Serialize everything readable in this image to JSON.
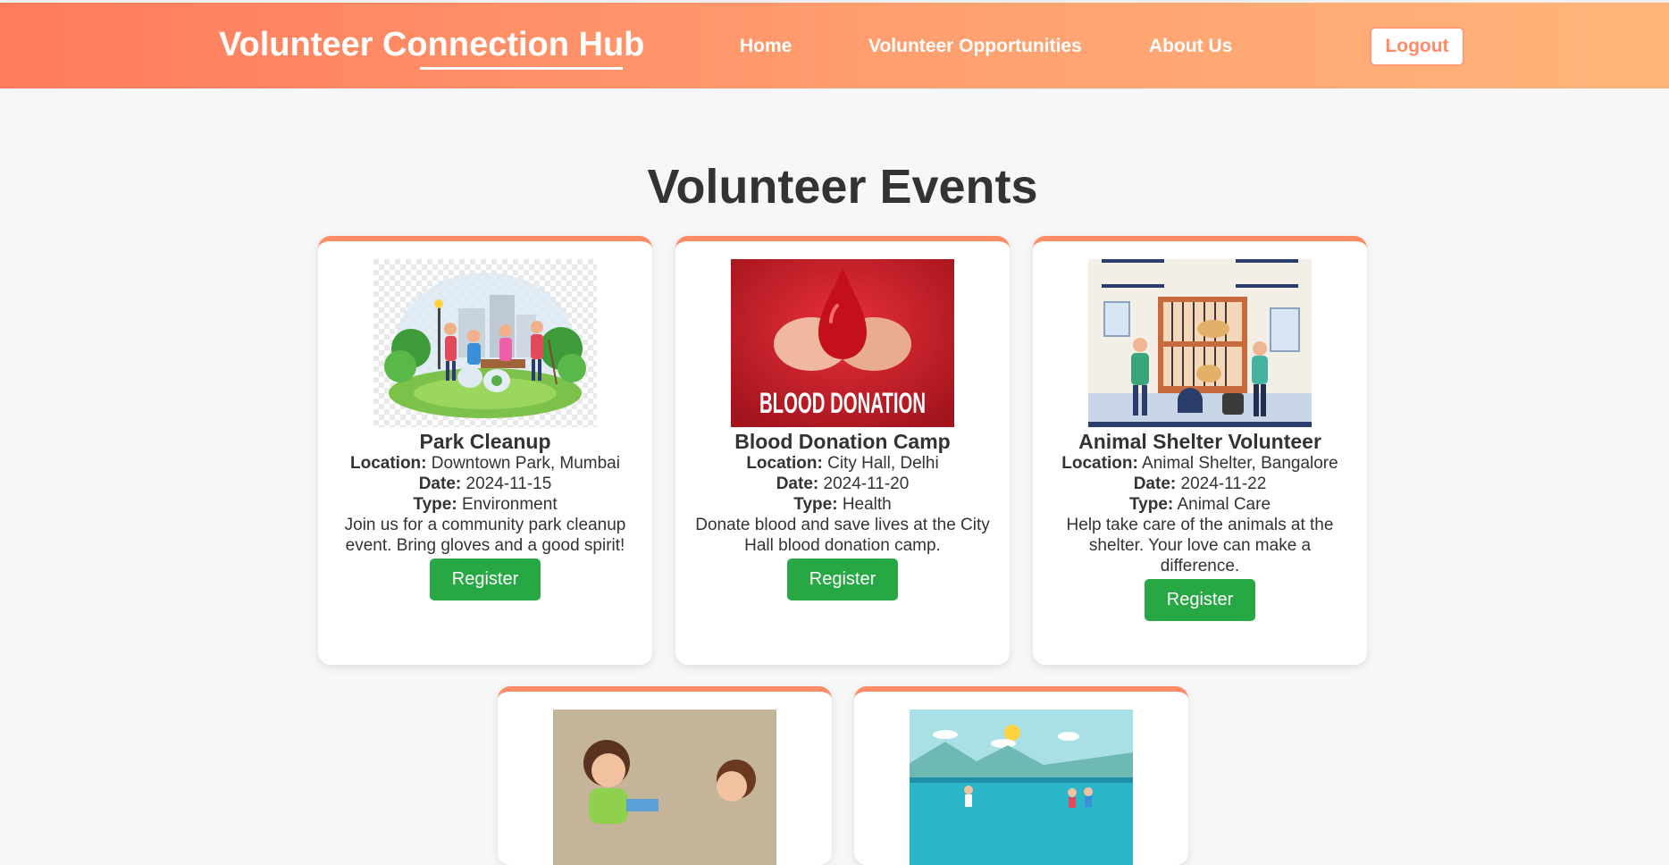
{
  "header": {
    "brand": "Volunteer Connection Hub",
    "nav": [
      "Home",
      "Volunteer Opportunities",
      "About Us"
    ],
    "logout": "Logout"
  },
  "main": {
    "title": "Volunteer Events",
    "events": [
      {
        "title": "Park Cleanup",
        "location_label": "Location:",
        "location": "Downtown Park, Mumbai",
        "date_label": "Date:",
        "date": "2024-11-15",
        "type_label": "Type:",
        "type": "Environment",
        "description": "Join us for a community park cleanup event. Bring gloves and a good spirit!",
        "button": "Register"
      },
      {
        "title": "Blood Donation Camp",
        "location_label": "Location:",
        "location": "City Hall, Delhi",
        "date_label": "Date:",
        "date": "2024-11-20",
        "type_label": "Type:",
        "type": "Health",
        "description": "Donate blood and save lives at the City Hall blood donation camp.",
        "button": "Register",
        "image_text": "BLOOD DONATION"
      },
      {
        "title": "Animal Shelter Volunteer",
        "location_label": "Location:",
        "location": "Animal Shelter, Bangalore",
        "date_label": "Date:",
        "date": "2024-11-22",
        "type_label": "Type:",
        "type": "Animal Care",
        "description": "Help take care of the animals at the shelter. Your love can make a difference.",
        "button": "Register"
      }
    ]
  },
  "colors": {
    "accent": "#ff7b5c",
    "accent_light": "#ffb57a",
    "register": "#28a745"
  }
}
